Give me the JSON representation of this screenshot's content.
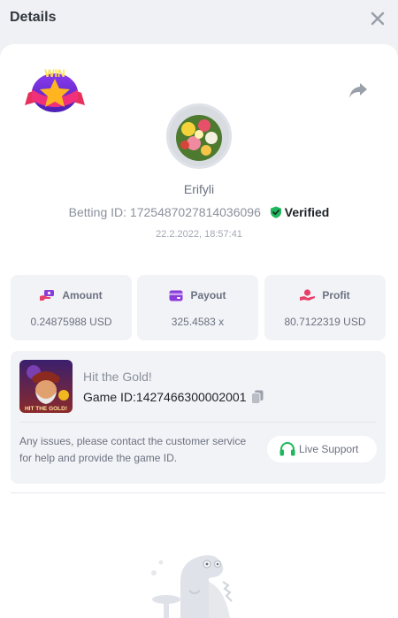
{
  "header": {
    "title": "Details"
  },
  "user": {
    "name": "Erifyli",
    "betting_id_label": "Betting ID:",
    "betting_id": "1725487027814036096",
    "verified": "Verified",
    "timestamp": "22.2.2022, 18:57:41"
  },
  "badge": {
    "text": "WIN"
  },
  "stats": [
    {
      "label": "Amount",
      "value": "0.24875988 USD",
      "icon": "money-hand-icon"
    },
    {
      "label": "Payout",
      "value": "325.4583 x",
      "icon": "card-icon"
    },
    {
      "label": "Profit",
      "value": "80.7122319 USD",
      "icon": "profit-hand-icon"
    }
  ],
  "game": {
    "name": "Hit the Gold!",
    "thumb_text": "HIT THE GOLD!",
    "id_label": "Game ID:",
    "id": "1427466300002001",
    "help": "Any issues, please contact the customer service for help and provide the game ID.",
    "support_label": "Live Support"
  },
  "colors": {
    "accent": "#24ee89",
    "verified_green": "#1cb85b",
    "icon_pink": "#e83f6a",
    "icon_purple": "#8b3bd9"
  }
}
